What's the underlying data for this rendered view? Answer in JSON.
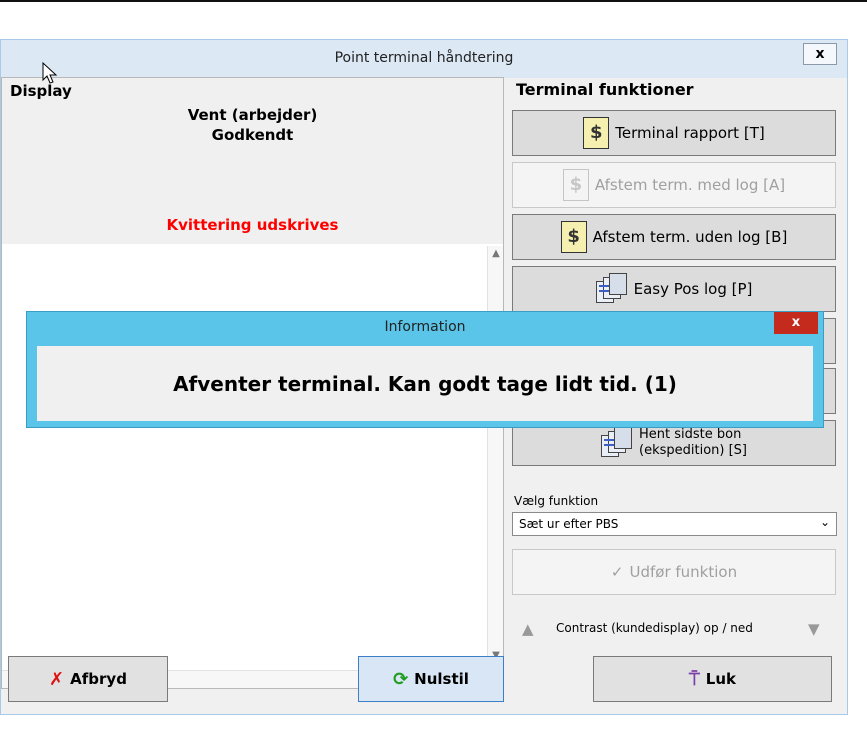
{
  "window": {
    "title": "Point terminal håndtering",
    "close_label": "x"
  },
  "display": {
    "label": "Display",
    "line1": "Vent (arbejder)",
    "line2": "Godkendt",
    "status_red": "Kvittering udskrives"
  },
  "terminal": {
    "title": "Terminal funktioner",
    "buttons": [
      {
        "label": "Terminal rapport [T]",
        "icon": "report-doc-icon",
        "enabled": true
      },
      {
        "label": "Afstem term. med log [A]",
        "icon": "report-doc-icon",
        "enabled": false
      },
      {
        "label": "Afstem term. uden log [B]",
        "icon": "report-doc-icon",
        "enabled": true
      },
      {
        "label": "Easy Pos log [P]",
        "icon": "log-pages-icon",
        "enabled": true
      },
      {
        "label": "",
        "enabled": true
      },
      {
        "label": "",
        "enabled": true
      },
      {
        "label_line1": "Hent sidste bon",
        "label_line2": "(ekspedition) [S]",
        "icon": "log-pages-icon",
        "enabled": true
      }
    ],
    "select_label": "Vælg funktion",
    "select_value": "Sæt ur efter PBS",
    "execute_label": "Udfør funktion",
    "contrast_label": "Contrast (kundedisplay) op / ned"
  },
  "footer": {
    "afbryd_label": "Afbryd",
    "nulstil_label": "Nulstil",
    "luk_label": "Luk"
  },
  "dialog": {
    "title": "Information",
    "close_label": "x",
    "message": "Afventer terminal. Kan godt tage lidt tid. (1)"
  },
  "colors": {
    "status_red": "#ff0000",
    "dialog_frame": "#5ac5e8",
    "close_red": "#c42b1c"
  }
}
